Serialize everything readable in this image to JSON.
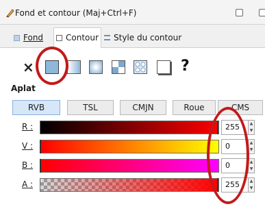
{
  "window": {
    "title": "Fond et contour (Maj+Ctrl+F)"
  },
  "tabs": [
    {
      "label": "Fond",
      "icon": "fill-icon"
    },
    {
      "label": "Contour",
      "icon": "stroke-outline-icon"
    },
    {
      "label": "Style du contour",
      "icon": "stroke-style-icon"
    }
  ],
  "paint_modes": [
    {
      "name": "no-paint",
      "glyph": "×"
    },
    {
      "name": "flat-color",
      "selected": true
    },
    {
      "name": "linear-gradient"
    },
    {
      "name": "radial-gradient"
    },
    {
      "name": "pattern"
    },
    {
      "name": "swatch"
    },
    {
      "name": "mesh"
    },
    {
      "name": "unset",
      "glyph": "?"
    }
  ],
  "section_label": "Aplat",
  "color_models": [
    {
      "label": "RVB",
      "selected": true
    },
    {
      "label": "TSL",
      "selected": false
    },
    {
      "label": "CMJN",
      "selected": false
    },
    {
      "label": "Roue",
      "selected": false
    },
    {
      "label": "CMS",
      "selected": false
    }
  ],
  "channels": [
    {
      "label": "R",
      "suffix": " :",
      "value": "255"
    },
    {
      "label": "V",
      "suffix": " :",
      "value": "0"
    },
    {
      "label": "B",
      "suffix": " :",
      "value": "0"
    },
    {
      "label": "A",
      "suffix": " :",
      "value": "255"
    }
  ],
  "colors": {
    "accent_annotation": "#c21a1a",
    "selected_mode": "#8fb7d9",
    "current_color": "#ff0000"
  }
}
